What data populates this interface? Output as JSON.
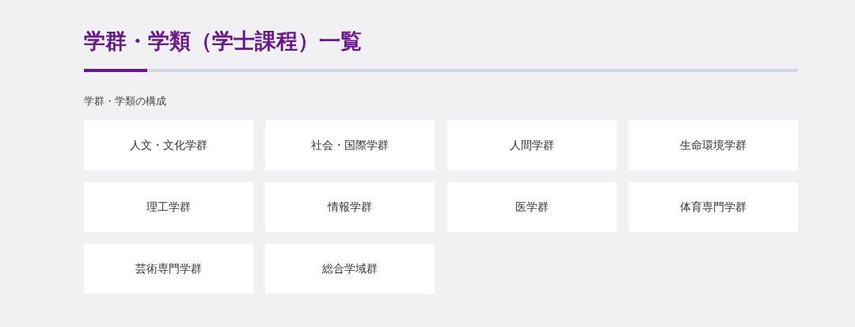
{
  "title": "学群・学類（学士課程）一覧",
  "section_heading": "学群・学類の構成",
  "items": [
    {
      "label": "人文・文化学群"
    },
    {
      "label": "社会・国際学群"
    },
    {
      "label": "人間学群"
    },
    {
      "label": "生命環境学群"
    },
    {
      "label": "理工学群"
    },
    {
      "label": "情報学群"
    },
    {
      "label": "医学群"
    },
    {
      "label": "体育専門学群"
    },
    {
      "label": "芸術専門学群"
    },
    {
      "label": "総合学域群"
    }
  ]
}
